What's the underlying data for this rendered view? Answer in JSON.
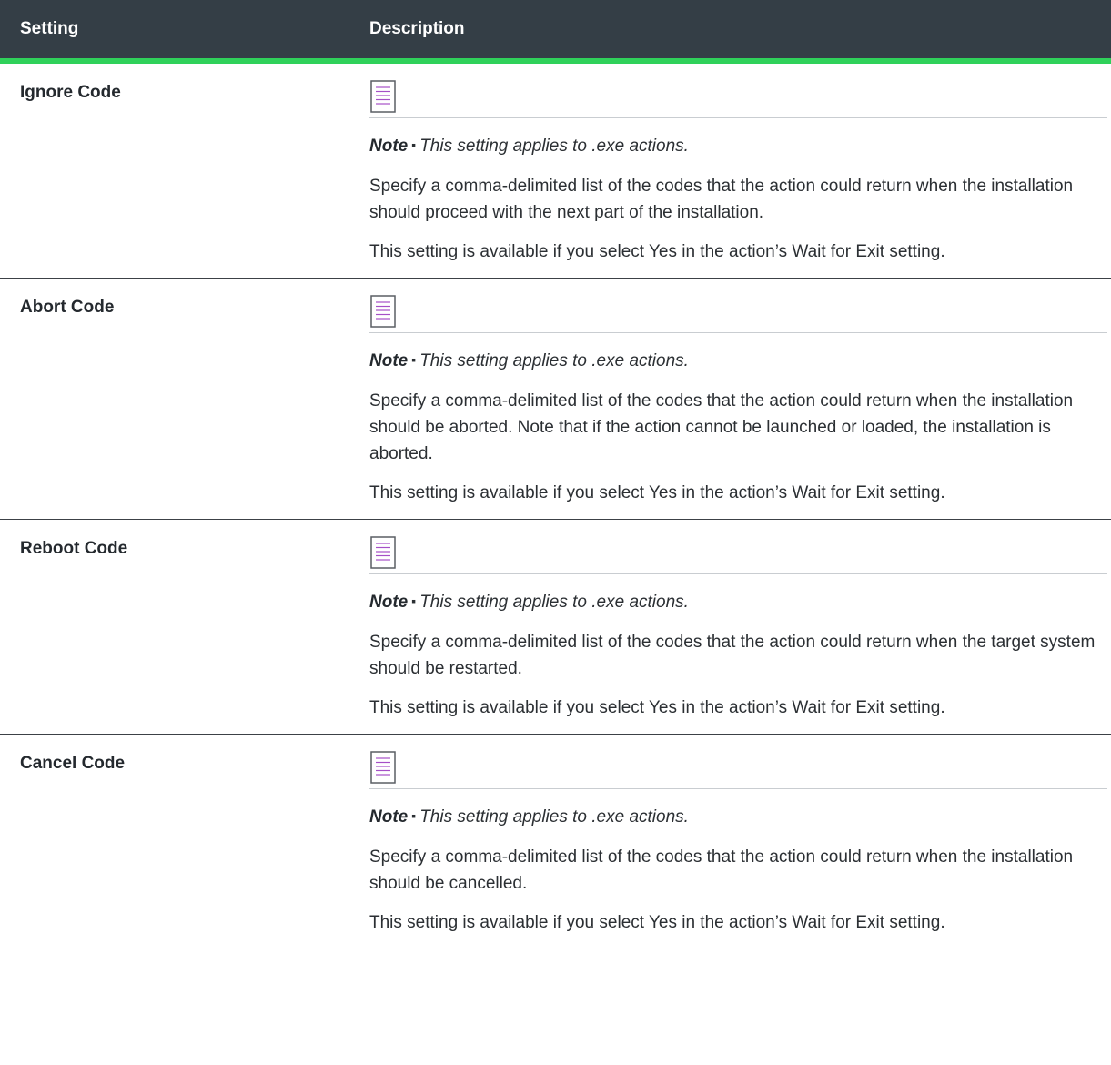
{
  "headers": {
    "setting": "Setting",
    "description": "Description"
  },
  "rows": [
    {
      "name": "Ignore Code",
      "note_label": "Note",
      "note_text": "This setting applies to .exe actions.",
      "paragraphs": [
        "Specify a comma-delimited list of the codes that the action could return when the installation should proceed with the next part of the installation.",
        "This setting is available if you select Yes in the action’s Wait for Exit setting."
      ]
    },
    {
      "name": "Abort Code",
      "note_label": "Note",
      "note_text": "This setting applies to .exe actions.",
      "paragraphs": [
        "Specify a comma-delimited list of the codes that the action could return when the installation should be aborted. Note that if the action cannot be launched or loaded, the installation is aborted.",
        "This setting is available if you select Yes in the action’s Wait for Exit setting."
      ]
    },
    {
      "name": "Reboot Code",
      "note_label": "Note",
      "note_text": "This setting applies to .exe actions.",
      "paragraphs": [
        "Specify a comma-delimited list of the codes that the action could return when the target system should be restarted.",
        "This setting is available if you select Yes in the action’s Wait for Exit setting."
      ]
    },
    {
      "name": "Cancel Code",
      "note_label": "Note",
      "note_text": "This setting applies to .exe actions.",
      "paragraphs": [
        "Specify a comma-delimited list of the codes that the action could return when the installation should be cancelled.",
        "This setting is available if you select Yes in the action’s Wait for Exit setting."
      ]
    }
  ],
  "icons": {
    "note": "note-document-icon"
  },
  "colors": {
    "header_bg": "#343e46",
    "header_accent": "#2fd15a",
    "icon_lines": "#a64fc7"
  }
}
